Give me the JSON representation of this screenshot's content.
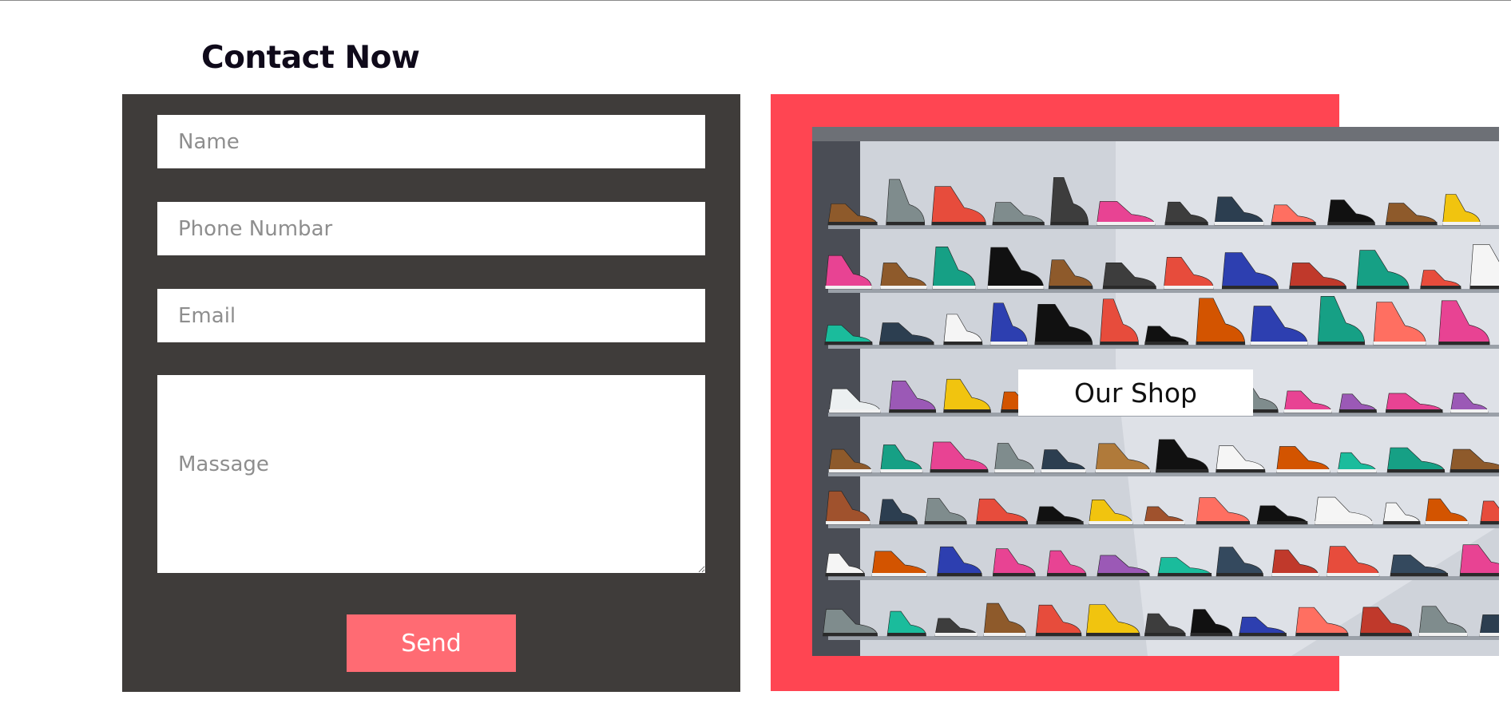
{
  "contact": {
    "title": "Contact Now",
    "fields": {
      "name_placeholder": "Name",
      "phone_placeholder": "Phone Numbar",
      "email_placeholder": "Email",
      "message_placeholder": "Massage"
    },
    "send_label": "Send"
  },
  "shop": {
    "label": "Our Shop",
    "image_icon": "shoe-store-photo"
  },
  "colors": {
    "form_bg": "#3f3c3a",
    "accent_frame": "#ff4552",
    "send_button": "#ff6b73",
    "title": "#0f0a1a"
  }
}
